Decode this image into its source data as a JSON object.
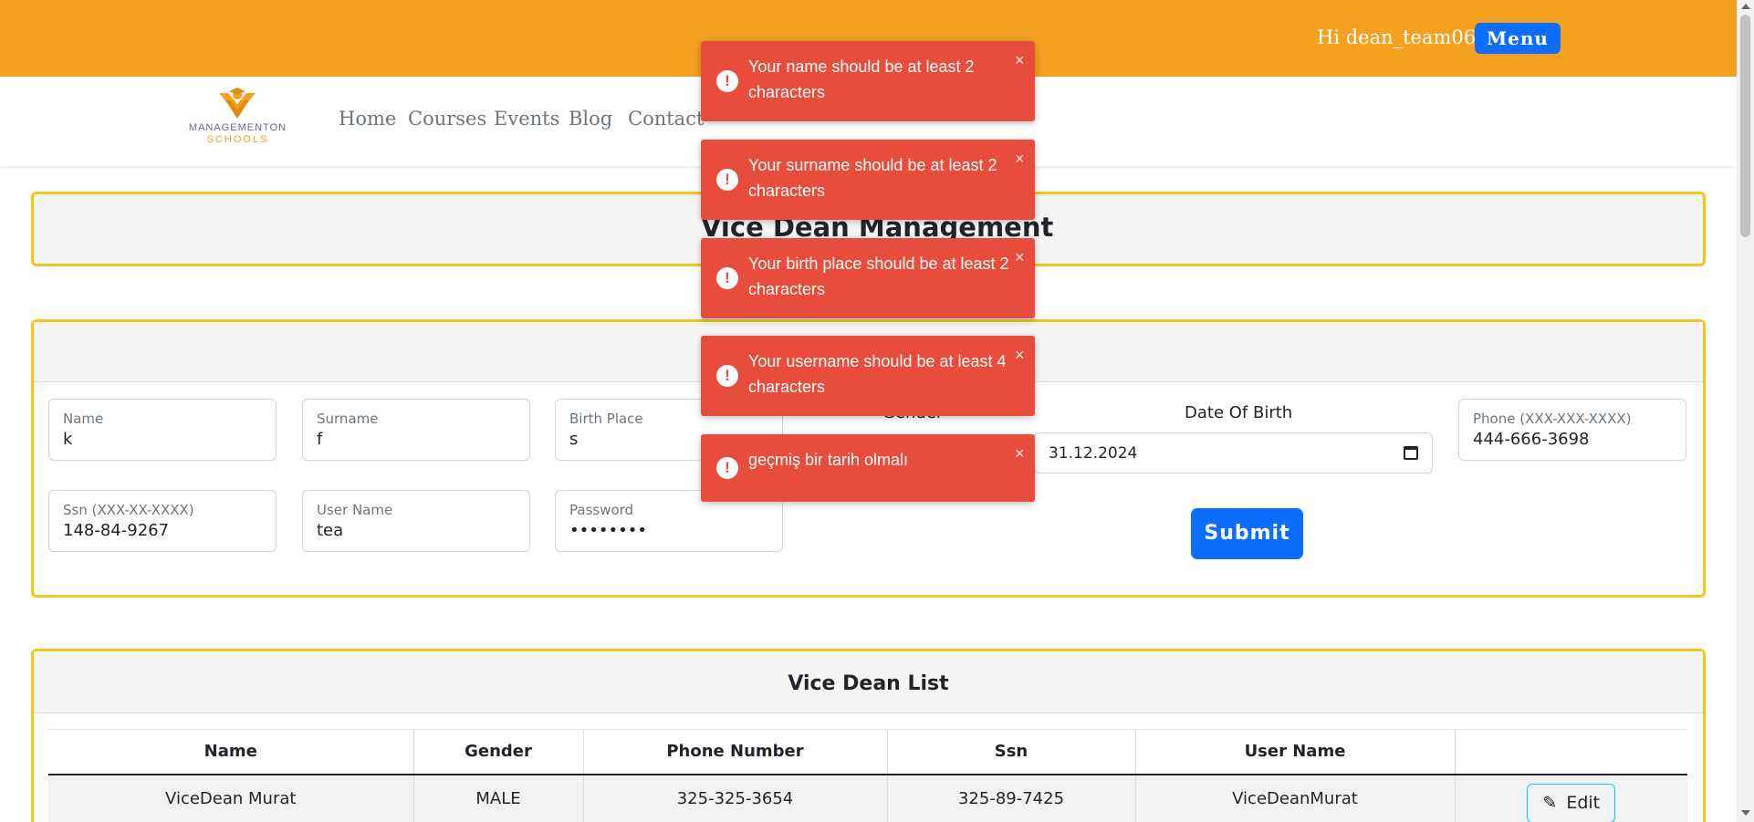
{
  "header": {
    "greeting": "Hi dean_team06",
    "menu_label": "Menu"
  },
  "logo": {
    "line1": "MANAGEMENTON",
    "line2": "SCHOOLS"
  },
  "nav": {
    "home": "Home",
    "courses": "Courses",
    "events": "Events",
    "blog": "Blog",
    "contact": "Contact"
  },
  "page_title": "Vice Dean Management",
  "form": {
    "name": {
      "label": "Name",
      "value": "k"
    },
    "surname": {
      "label": "Surname",
      "value": "f"
    },
    "birth_place": {
      "label": "Birth Place",
      "value": "s"
    },
    "gender_label": "Gender",
    "dob_label": "Date Of Birth",
    "dob_value": "31.12.2024",
    "phone": {
      "label": "Phone (XXX-XXX-XXXX)",
      "value": "444-666-3698"
    },
    "ssn": {
      "label": "Ssn (XXX-XX-XXXX)",
      "value": "148-84-9267"
    },
    "username": {
      "label": "User Name",
      "value": "tea"
    },
    "password": {
      "label": "Password",
      "value": "••••••••"
    },
    "submit_label": "Submit"
  },
  "list": {
    "title": "Vice Dean List",
    "headers": [
      "Name",
      "Gender",
      "Phone Number",
      "Ssn",
      "User Name",
      ""
    ],
    "rows": [
      {
        "name": "ViceDean Murat",
        "gender": "MALE",
        "phone": "325-325-3654",
        "ssn": "325-89-7425",
        "username": "ViceDeanMurat",
        "edit_label": "Edit"
      }
    ]
  },
  "toasts": [
    {
      "message": "Your name should be at least 2 characters"
    },
    {
      "message": "Your surname should be at least 2 characters"
    },
    {
      "message": "Your birth place should be at least 2 characters"
    },
    {
      "message": "Your username should be at least 4 characters"
    },
    {
      "message": "geçmiş bir tarih olmalı"
    }
  ],
  "toast_icon": "!",
  "toast_close": "×",
  "colors": {
    "topbar": "#f4a020",
    "primary": "#0d6efd",
    "toast": "#e74c3c",
    "card_border": "#f5c518"
  }
}
